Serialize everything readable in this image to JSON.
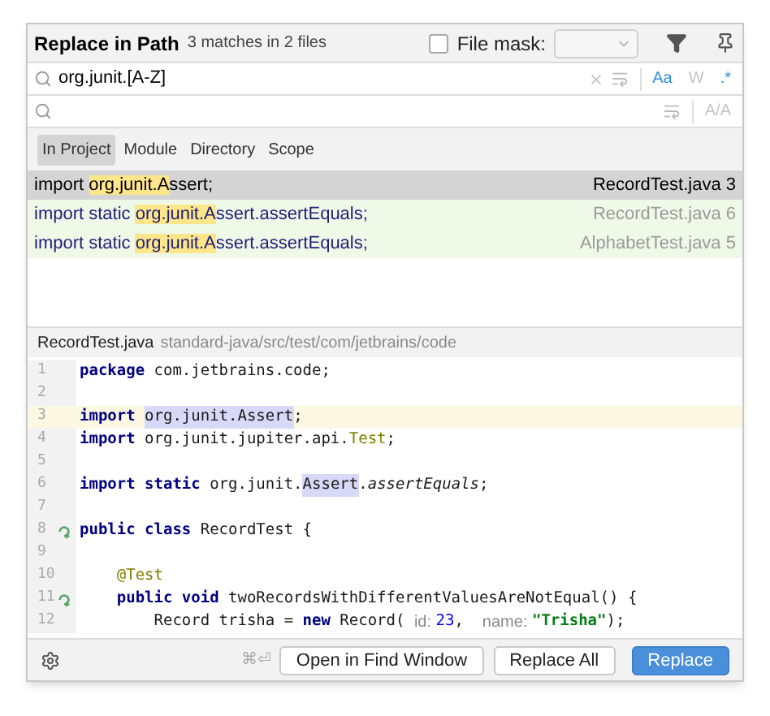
{
  "dialog": {
    "title": "Replace in Path",
    "summary": "3 matches in 2 files"
  },
  "file_mask": {
    "label": "File mask:",
    "checked": false
  },
  "search": {
    "value": "org.junit.[A-Z]",
    "toggles": [
      {
        "label": "Aa",
        "on": true
      },
      {
        "label": "W",
        "on": false
      },
      {
        "label": ".*",
        "on": true
      }
    ]
  },
  "replace": {
    "toggles": [
      {
        "label": "A/A",
        "on": false
      }
    ]
  },
  "scopes": [
    {
      "label": "In Project",
      "selected": true
    },
    {
      "label": "Module",
      "selected": false
    },
    {
      "label": "Directory",
      "selected": false
    },
    {
      "label": "Scope",
      "selected": false
    }
  ],
  "results": [
    {
      "before": "import ",
      "match": "org.junit.A",
      "after": "ssert;",
      "file": "RecordTest.java",
      "line": "3",
      "selected": true
    },
    {
      "before": "import static ",
      "match": "org.junit.A",
      "after": "ssert.assertEquals;",
      "file": "RecordTest.java",
      "line": "6",
      "selected": false
    },
    {
      "before": "import static ",
      "match": "org.junit.A",
      "after": "ssert.assertEquals;",
      "file": "AlphabetTest.java",
      "line": "5",
      "selected": false
    }
  ],
  "preview": {
    "file": "RecordTest.java",
    "path": "standard-java/src/test/com/jetbrains/code",
    "lines": [
      {
        "number": "1",
        "current": false,
        "gutter": false,
        "tokens": [
          {
            "kind": "kw",
            "text": "package"
          },
          {
            "kind": "plain",
            "text": " com.jetbrains.code;"
          }
        ]
      },
      {
        "number": "2",
        "current": false,
        "gutter": false
      },
      {
        "number": "3",
        "current": true,
        "gutter": false,
        "tokens": [
          {
            "kind": "kw",
            "text": "import "
          },
          {
            "kind": "match",
            "text": "org.junit.Assert"
          },
          {
            "kind": "plain",
            "text": ";"
          }
        ]
      },
      {
        "number": "4",
        "current": false,
        "gutter": false,
        "tokens": [
          {
            "kind": "kw",
            "text": "import"
          },
          {
            "kind": "plain",
            "text": " org.junit.jupiter.api."
          },
          {
            "kind": "ann",
            "text": "Test"
          },
          {
            "kind": "plain",
            "text": ";"
          }
        ]
      },
      {
        "number": "5",
        "current": false,
        "gutter": false
      },
      {
        "number": "6",
        "current": false,
        "gutter": false,
        "tokens": [
          {
            "kind": "kw",
            "text": "import static"
          },
          {
            "kind": "plain",
            "text": " org.junit."
          },
          {
            "kind": "match",
            "text": "Assert"
          },
          {
            "kind": "plain",
            "text": "."
          },
          {
            "kind": "italic",
            "text": "assertEquals"
          },
          {
            "kind": "plain",
            "text": ";"
          }
        ]
      },
      {
        "number": "7",
        "current": false,
        "gutter": false
      },
      {
        "number": "8",
        "current": false,
        "gutter": true,
        "tokens": [
          {
            "kind": "kw",
            "text": "public class"
          },
          {
            "kind": "plain",
            "text": " RecordTest {"
          }
        ]
      },
      {
        "number": "9",
        "current": false,
        "gutter": false
      },
      {
        "number": "10",
        "current": false,
        "gutter": false,
        "tokens": [
          {
            "kind": "ann",
            "text": "    @Test"
          }
        ]
      },
      {
        "number": "11",
        "current": false,
        "gutter": true,
        "tokens": [
          {
            "kind": "kw",
            "text": "    public void"
          },
          {
            "kind": "plain",
            "text": " twoRecordsWithDifferentValuesAreNotEqual() {"
          }
        ]
      },
      {
        "number": "12",
        "current": false,
        "gutter": false,
        "tokens": [
          {
            "kind": "plain",
            "text": "        Record trisha = "
          },
          {
            "kind": "kw",
            "text": "new"
          },
          {
            "kind": "plain",
            "text": " Record( "
          },
          {
            "kind": "hint",
            "text": "id: "
          },
          {
            "kind": "num",
            "text": "23"
          },
          {
            "kind": "plain",
            "text": ",  "
          },
          {
            "kind": "hint",
            "text": "name: "
          },
          {
            "kind": "str",
            "text": "\"Trisha\""
          },
          {
            "kind": "plain",
            "text": ");"
          }
        ]
      }
    ]
  },
  "footer": {
    "shortcut": "⌘⏎",
    "buttons": [
      {
        "label": "Open in Find Window",
        "kind": "default"
      },
      {
        "label": "Replace All",
        "kind": "default"
      },
      {
        "label": "Replace",
        "kind": "primary"
      }
    ]
  }
}
